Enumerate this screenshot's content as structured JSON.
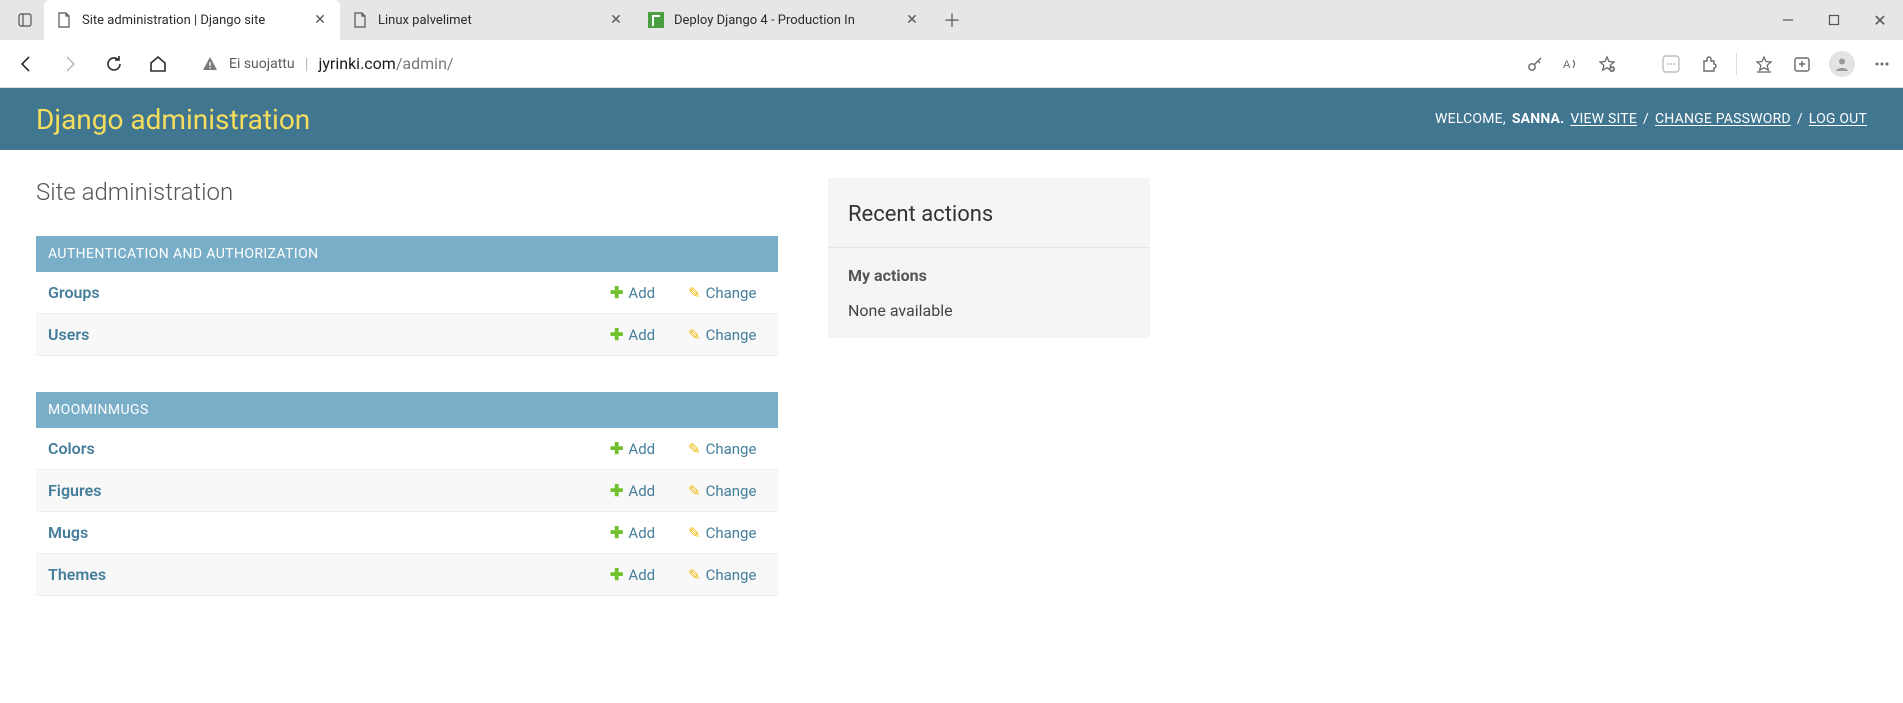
{
  "browser": {
    "tabs": [
      {
        "title": "Site administration | Django site",
        "favicon": "page"
      },
      {
        "title": "Linux palvelimet",
        "favicon": "page"
      },
      {
        "title": "Deploy Django 4 - Production In",
        "favicon": "tero"
      }
    ],
    "address": {
      "secure_label": "Ei suojattu",
      "host": "jyrinki.com",
      "path": "/admin/"
    }
  },
  "django": {
    "brand": "Django administration",
    "userlinks": {
      "welcome": "WELCOME,",
      "username": "SANNA",
      "view_site": "VIEW SITE",
      "change_password": "CHANGE PASSWORD",
      "logout": "LOG OUT"
    },
    "page_title": "Site administration",
    "add_label": "Add",
    "change_label": "Change",
    "modules": [
      {
        "caption": "AUTHENTICATION AND AUTHORIZATION",
        "models": [
          {
            "name": "Groups"
          },
          {
            "name": "Users"
          }
        ]
      },
      {
        "caption": "MOOMINMUGS",
        "models": [
          {
            "name": "Colors"
          },
          {
            "name": "Figures"
          },
          {
            "name": "Mugs"
          },
          {
            "name": "Themes"
          }
        ]
      }
    ],
    "recent": {
      "title": "Recent actions",
      "subtitle": "My actions",
      "empty": "None available"
    }
  }
}
